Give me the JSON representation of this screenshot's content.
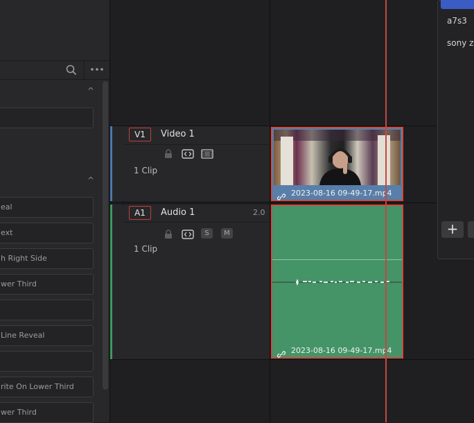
{
  "effects_panel": {
    "items": [
      "eal",
      "ext",
      "h Right Side",
      "wer Third",
      "",
      "Line Reveal",
      "",
      "rite On Lower Third",
      "wer Third"
    ]
  },
  "tracks": {
    "video": {
      "tag": "V1",
      "name": "Video 1",
      "clip_count": "1 Clip"
    },
    "audio": {
      "tag": "A1",
      "name": "Audio 1",
      "channel": "2.0",
      "clip_count": "1 Clip",
      "solo_label": "S",
      "mute_label": "M"
    }
  },
  "clips": {
    "video": {
      "name": "2023-08-16 09-49-17.mp4"
    },
    "audio": {
      "name": "2023-08-16 09-49-17.mp4"
    }
  },
  "right_panel": {
    "items": [
      "a7s3",
      "sony z"
    ],
    "add_label": "+"
  },
  "colors": {
    "video_track": "#587fa9",
    "audio_track": "#449468",
    "playhead": "#c8473f",
    "selected_border": "#d24a3e"
  }
}
